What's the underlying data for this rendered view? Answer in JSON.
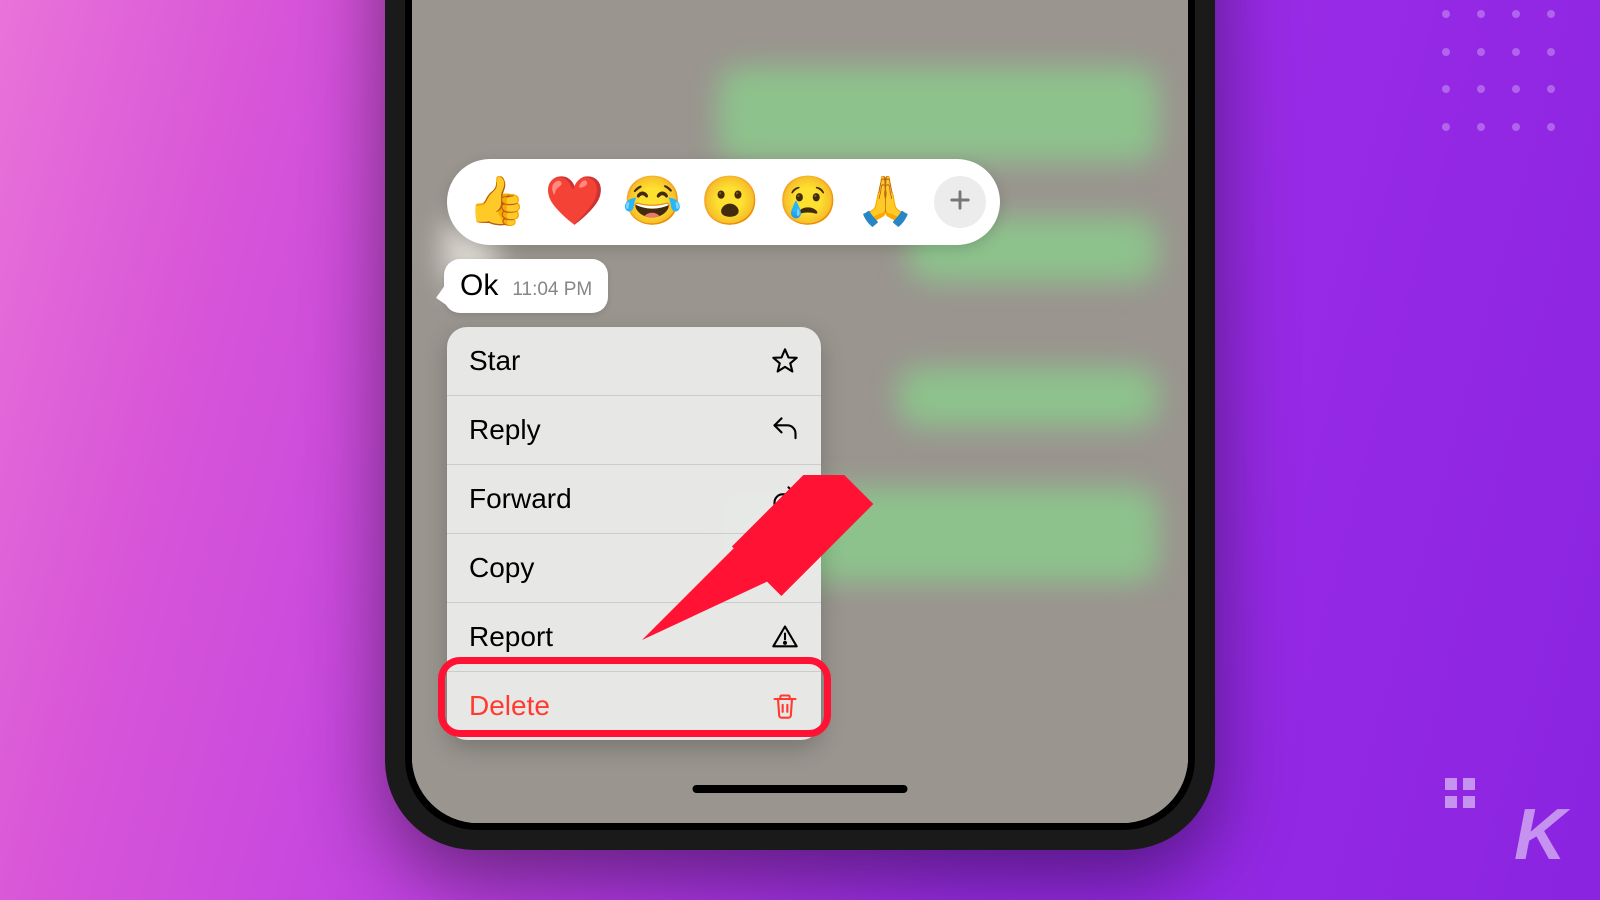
{
  "reactions": [
    "👍",
    "❤️",
    "😂",
    "😮",
    "😢",
    "🙏"
  ],
  "message": {
    "text": "Ok",
    "time": "11:04 PM"
  },
  "menu": {
    "star": "Star",
    "reply": "Reply",
    "forward": "Forward",
    "copy": "Copy",
    "report": "Report",
    "delete": "Delete"
  },
  "watermark": "K",
  "colors": {
    "destructive": "#ff3b30",
    "highlight": "#ff1233"
  }
}
